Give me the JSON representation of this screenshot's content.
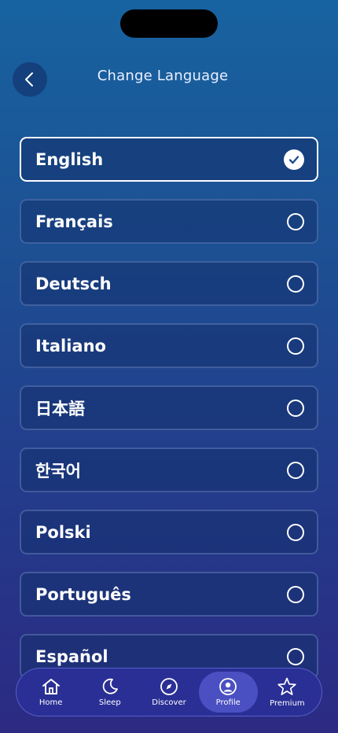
{
  "header": {
    "title": "Change Language",
    "back_icon": "chevron-left-icon"
  },
  "languages": [
    {
      "label": "English",
      "selected": true
    },
    {
      "label": "Français",
      "selected": false
    },
    {
      "label": "Deutsch",
      "selected": false
    },
    {
      "label": "Italiano",
      "selected": false
    },
    {
      "label": "日本語",
      "selected": false
    },
    {
      "label": "한국어",
      "selected": false
    },
    {
      "label": "Polski",
      "selected": false
    },
    {
      "label": "Português",
      "selected": false
    },
    {
      "label": "Español",
      "selected": false
    }
  ],
  "tabbar": {
    "items": [
      {
        "label": "Home",
        "icon": "home-icon",
        "active": false
      },
      {
        "label": "Sleep",
        "icon": "moon-icon",
        "active": false
      },
      {
        "label": "Discover",
        "icon": "compass-icon",
        "active": false
      },
      {
        "label": "Profile",
        "icon": "profile-icon",
        "active": true
      },
      {
        "label": "Premium",
        "icon": "star-icon",
        "active": false
      }
    ]
  },
  "colors": {
    "background_top": "#1763a0",
    "background_bottom": "#2c2a83",
    "tabbar": "#2a2f95",
    "tab_active": "#4a4fc2"
  }
}
